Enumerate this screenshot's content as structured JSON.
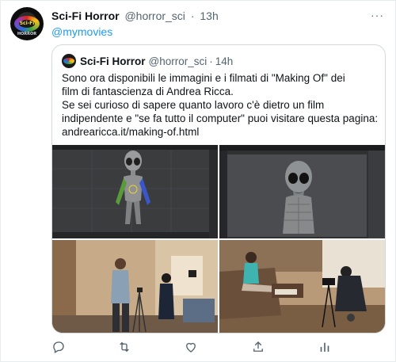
{
  "tweet": {
    "author_name": "Sci-Fi Horror",
    "author_handle": "@horror_sci",
    "separator": "·",
    "time": "13h",
    "reply_to": "@mymovies",
    "more_label": "···",
    "avatar_text_top": "Sci-Fi",
    "avatar_text_bottom": "HORROR"
  },
  "quote": {
    "author_name": "Sci-Fi Horror",
    "author_handle": "@horror_sci",
    "separator": "·",
    "time": "14h",
    "lines": [
      "Sono ora disponibili le immagini e i filmati di \"Making Of\" dei",
      "film di fantascienza di Andrea Ricca.",
      "Se sei curioso di sapere quanto lavoro c'è dietro un film",
      "indipendente e \"se fa tutto il computer\" puoi visitare questa pagina:",
      "andrearicca.it/making-of.html"
    ]
  },
  "actions": [
    "reply-icon",
    "retweet-icon",
    "like-icon",
    "share-icon",
    "analytics-icon"
  ],
  "colors": {
    "link": "#1d9bf0",
    "secondary": "#536471",
    "border": "#cfd9de"
  }
}
